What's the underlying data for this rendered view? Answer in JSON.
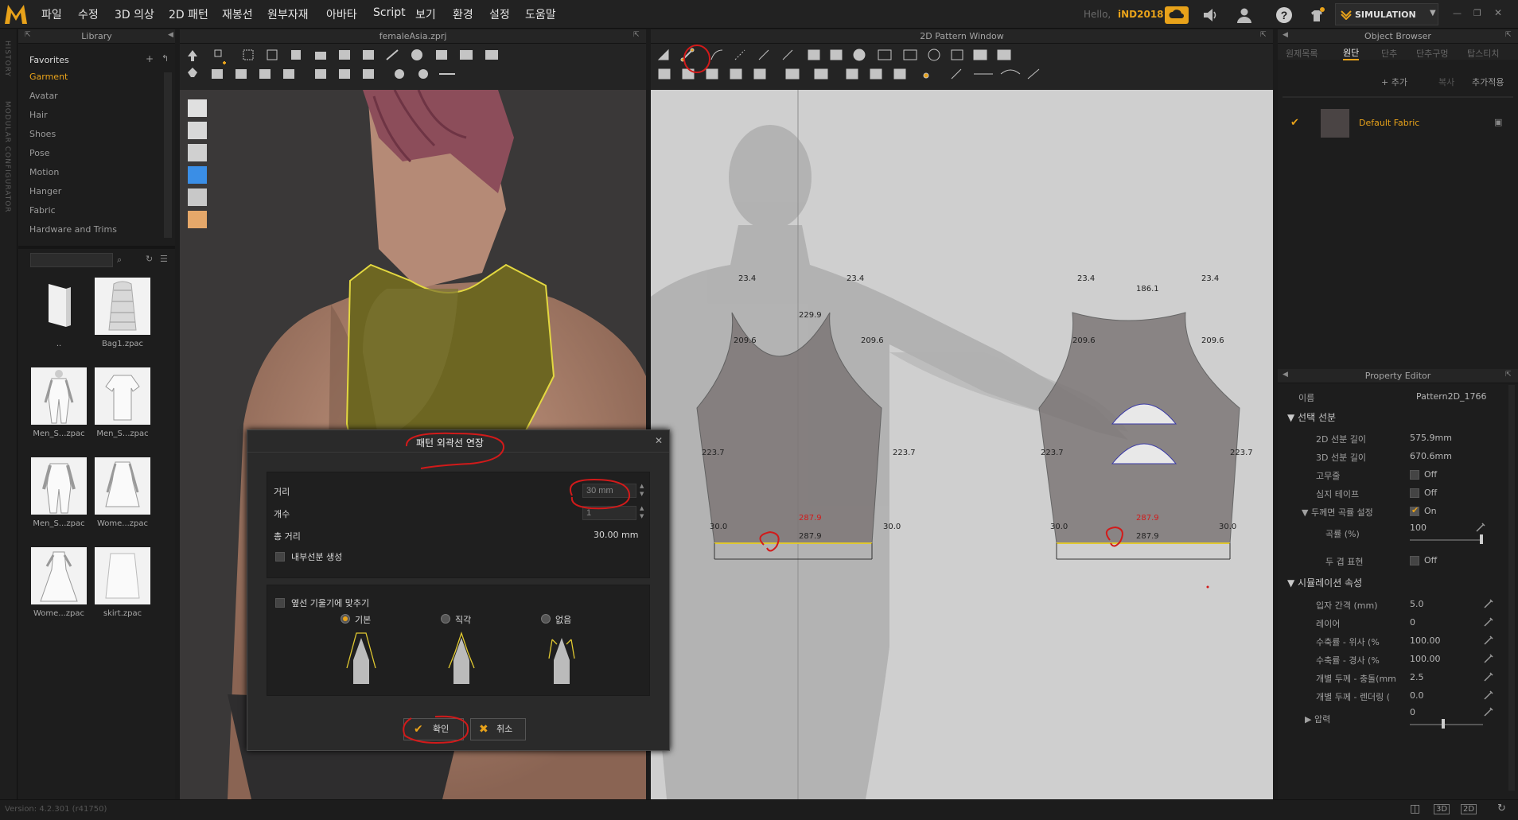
{
  "menubar": {
    "items": [
      "파일",
      "수정",
      "3D 의상",
      "2D 패턴",
      "재봉선",
      "원부자재",
      "아바타",
      "Script",
      "보기",
      "환경",
      "설정",
      "도움말"
    ],
    "hello": "Hello,",
    "user": "iND2018",
    "simulation": "SIMULATION"
  },
  "side_strip": {
    "history": "HISTORY",
    "modular": "MODULAR CONFIGURATOR"
  },
  "library": {
    "title": "Library",
    "favorites": "Favorites",
    "items": [
      "Garment",
      "Avatar",
      "Hair",
      "Shoes",
      "Pose",
      "Motion",
      "Hanger",
      "Fabric",
      "Hardware and Trims"
    ],
    "files": [
      {
        "name": ".."
      },
      {
        "name": "Bag1.zpac"
      },
      {
        "name": "Men_S...zpac"
      },
      {
        "name": "Men_S...zpac"
      },
      {
        "name": "Men_S...zpac"
      },
      {
        "name": "Wome...zpac"
      },
      {
        "name": "Wome...zpac"
      },
      {
        "name": "skirt.zpac"
      }
    ]
  },
  "view3d": {
    "title": "femaleAsia.zprj"
  },
  "view2d": {
    "title": "2D Pattern Window"
  },
  "pattern": {
    "left": [
      "23.4",
      "23.4",
      "229.9",
      "209.6",
      "209.6",
      "223.7",
      "223.7",
      "287.9",
      "30.0",
      "30.0",
      "287.9"
    ],
    "right": [
      "23.4",
      "23.4",
      "186.1",
      "209.6",
      "209.6",
      "223.7",
      "223.7",
      "287.9",
      "30.0",
      "30.0",
      "287.9"
    ]
  },
  "object_browser": {
    "title": "Object Browser",
    "tabs": [
      "원제목록",
      "원단",
      "단추",
      "단추구멍",
      "탑스티치"
    ],
    "add": "+ 추가",
    "copy": "복사",
    "apply": "추가적용",
    "fabric": "Default Fabric",
    "fabric_color": "#4a4444"
  },
  "property_editor": {
    "title": "Property Editor",
    "name_label": "이름",
    "name_value": "Pattern2D_1766",
    "sec_line": "선택 선분",
    "len2d_label": "2D 선분 길이",
    "len2d": "575.9mm",
    "len3d_label": "3D 선분 길이",
    "len3d": "670.6mm",
    "elastic_label": "고무줄",
    "elastic": "Off",
    "tape_label": "심지 테이프",
    "tape": "Off",
    "thick_label": "두께면 곡률 설정",
    "thick": "On",
    "curve_label": "곡률 (%)",
    "curve": "100",
    "thickrender_label": "두 겹 표현",
    "thickrender": "Off",
    "curve_level": 1.0,
    "sec_sim": "시뮬레이션 속성",
    "particle_label": "입자 간격 (mm)",
    "particle": "5.0",
    "layer_label": "레이어",
    "layer": "0",
    "shrink_w_label": "수축률 - 위사 (%",
    "shrink_w": "100.00",
    "shrink_h_label": "수축률 - 경사 (%",
    "shrink_h": "100.00",
    "thick_col_label": "개별 두께 - 충돌(mm",
    "thick_col": "2.5",
    "thick_ren_label": "개별 두께 - 렌더링 (",
    "thick_ren": "0.0",
    "press_label": "압력",
    "press": "0",
    "press_level": 0.45
  },
  "dialog": {
    "title": "패턴 외곽선 연장",
    "distance_label": "거리",
    "distance": "30 mm",
    "count_label": "개수",
    "count": "1",
    "total_label": "총 거리",
    "total": "30.00 mm",
    "inner_label": "내부선분 생성",
    "fit_label": "옆선 기울기에 맞추기",
    "opt_basic": "기본",
    "opt_right": "직각",
    "opt_none": "없음",
    "ok": "확인",
    "cancel": "취소"
  },
  "status": {
    "version": "Version: 4.2.301 (r41750)"
  },
  "colors": {
    "accent": "#e8a21a",
    "annotation": "#d21a1a"
  }
}
